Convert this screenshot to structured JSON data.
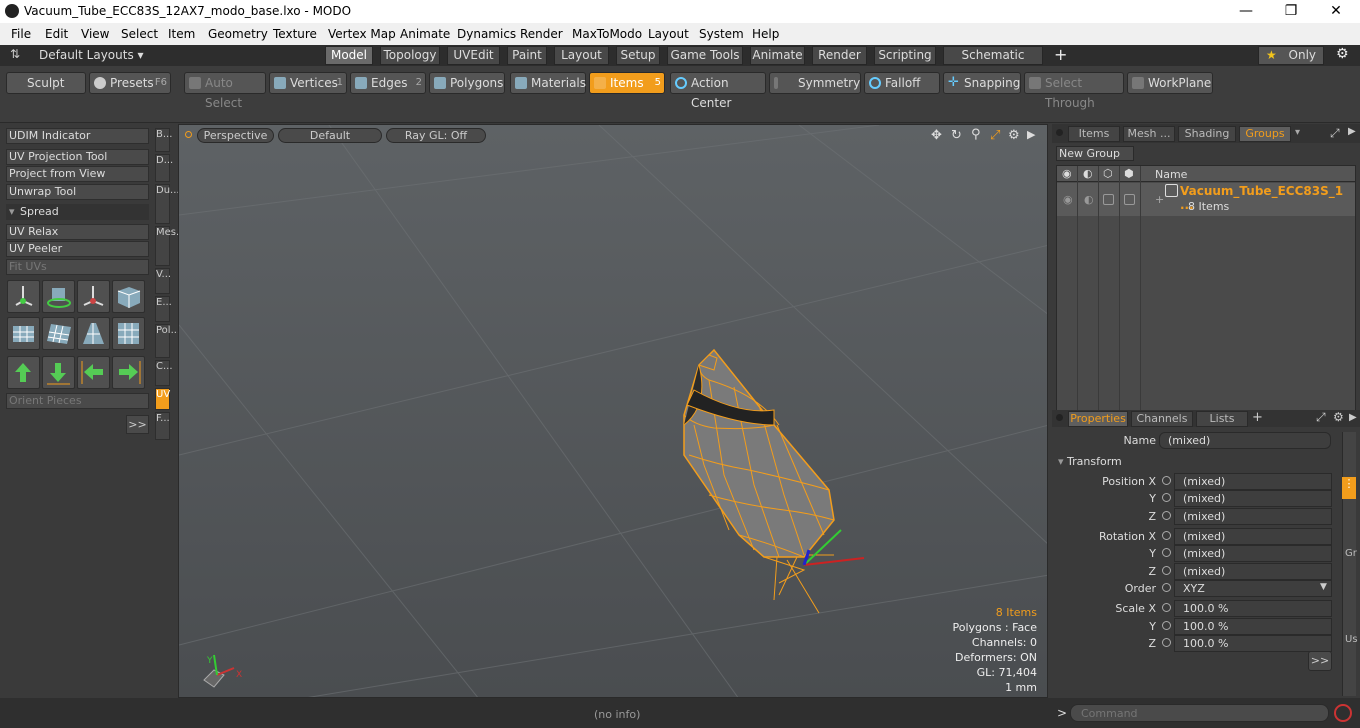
{
  "window": {
    "title": "Vacuum_Tube_ECC83S_12AX7_modo_base.lxo - MODO",
    "minimize": "—",
    "maximize": "❐",
    "close": "✕"
  },
  "menu": [
    "File",
    "Edit",
    "View",
    "Select",
    "Item",
    "Geometry",
    "Texture",
    "Vertex Map",
    "Animate",
    "Dynamics",
    "Render",
    "MaxToModo",
    "Layout",
    "System",
    "Help"
  ],
  "layout_bar": {
    "layouts_label": "Default Layouts ▾",
    "tabs": [
      "Model",
      "Topology",
      "UVEdit",
      "Paint",
      "Layout",
      "Setup",
      "Game Tools",
      "Animate",
      "Render",
      "Scripting",
      "Schematic Fusion"
    ],
    "active_tab": "Model",
    "add": "+",
    "only": "Only",
    "only_star": "★",
    "gear": "⚙"
  },
  "toolbar": {
    "sculpt": "Sculpt",
    "presets": "Presets",
    "presets_key": "F6",
    "auto_select": "Auto Select",
    "vertices": "Vertices",
    "vertices_num": "1",
    "edges": "Edges",
    "edges_num": "2",
    "polygons": "Polygons",
    "materials": "Materials",
    "items": "Items",
    "items_num": "5",
    "action_center": "Action Center",
    "symmetry": "Symmetry",
    "falloff": "Falloff",
    "snapping": "Snapping",
    "select_through": "Select Through",
    "workplane": "WorkPlane"
  },
  "left_panel": {
    "udim": "UDIM Indicator",
    "uv_projection": "UV Projection Tool",
    "project_from_view": "Project from View",
    "unwrap_tool": "Unwrap Tool",
    "spread": "Spread",
    "uv_relax": "UV Relax",
    "uv_peeler": "UV Peeler",
    "fit_uvs": "Fit UVs",
    "orient_pieces": "Orient Pieces",
    "more": ">>",
    "vtabs": [
      "B...",
      "D...",
      "Du...",
      "Mes...",
      "V...",
      "E...",
      "Pol...",
      "C...",
      "UV",
      "F..."
    ]
  },
  "viewport": {
    "perspective": "Perspective",
    "default": "Default",
    "raygl": "Ray GL: Off",
    "stats": {
      "items": "8 Items",
      "polygons": "Polygons : Face",
      "channels": "Channels: 0",
      "deformers": "Deformers: ON",
      "gl": "GL: 71,404",
      "unit": "1 mm"
    }
  },
  "scene_panel": {
    "tabs": [
      "Items",
      "Mesh ...",
      "Shading",
      "Groups"
    ],
    "active_tab": "Groups",
    "new_group": "New Group",
    "name_header": "Name",
    "group_name": "Vacuum_Tube_ECC83S_1 ...",
    "group_count": "8 Items"
  },
  "properties": {
    "tabs": [
      "Properties",
      "Channels",
      "Lists"
    ],
    "active_tab": "Properties",
    "add": "+",
    "name_label": "Name",
    "name_value": "(mixed)",
    "transform": "Transform",
    "position_label": "Position X",
    "rotation_label": "Rotation X",
    "scale_label": "Scale X",
    "y": "Y",
    "z": "Z",
    "mixed": "(mixed)",
    "order_label": "Order",
    "order_value": "XYZ",
    "scale_value": "100.0 %",
    "more": ">>",
    "side_gr": "Gr",
    "side_us": "Us"
  },
  "status": {
    "info": "(no info)",
    "prompt": ">",
    "command_placeholder": "Command"
  }
}
